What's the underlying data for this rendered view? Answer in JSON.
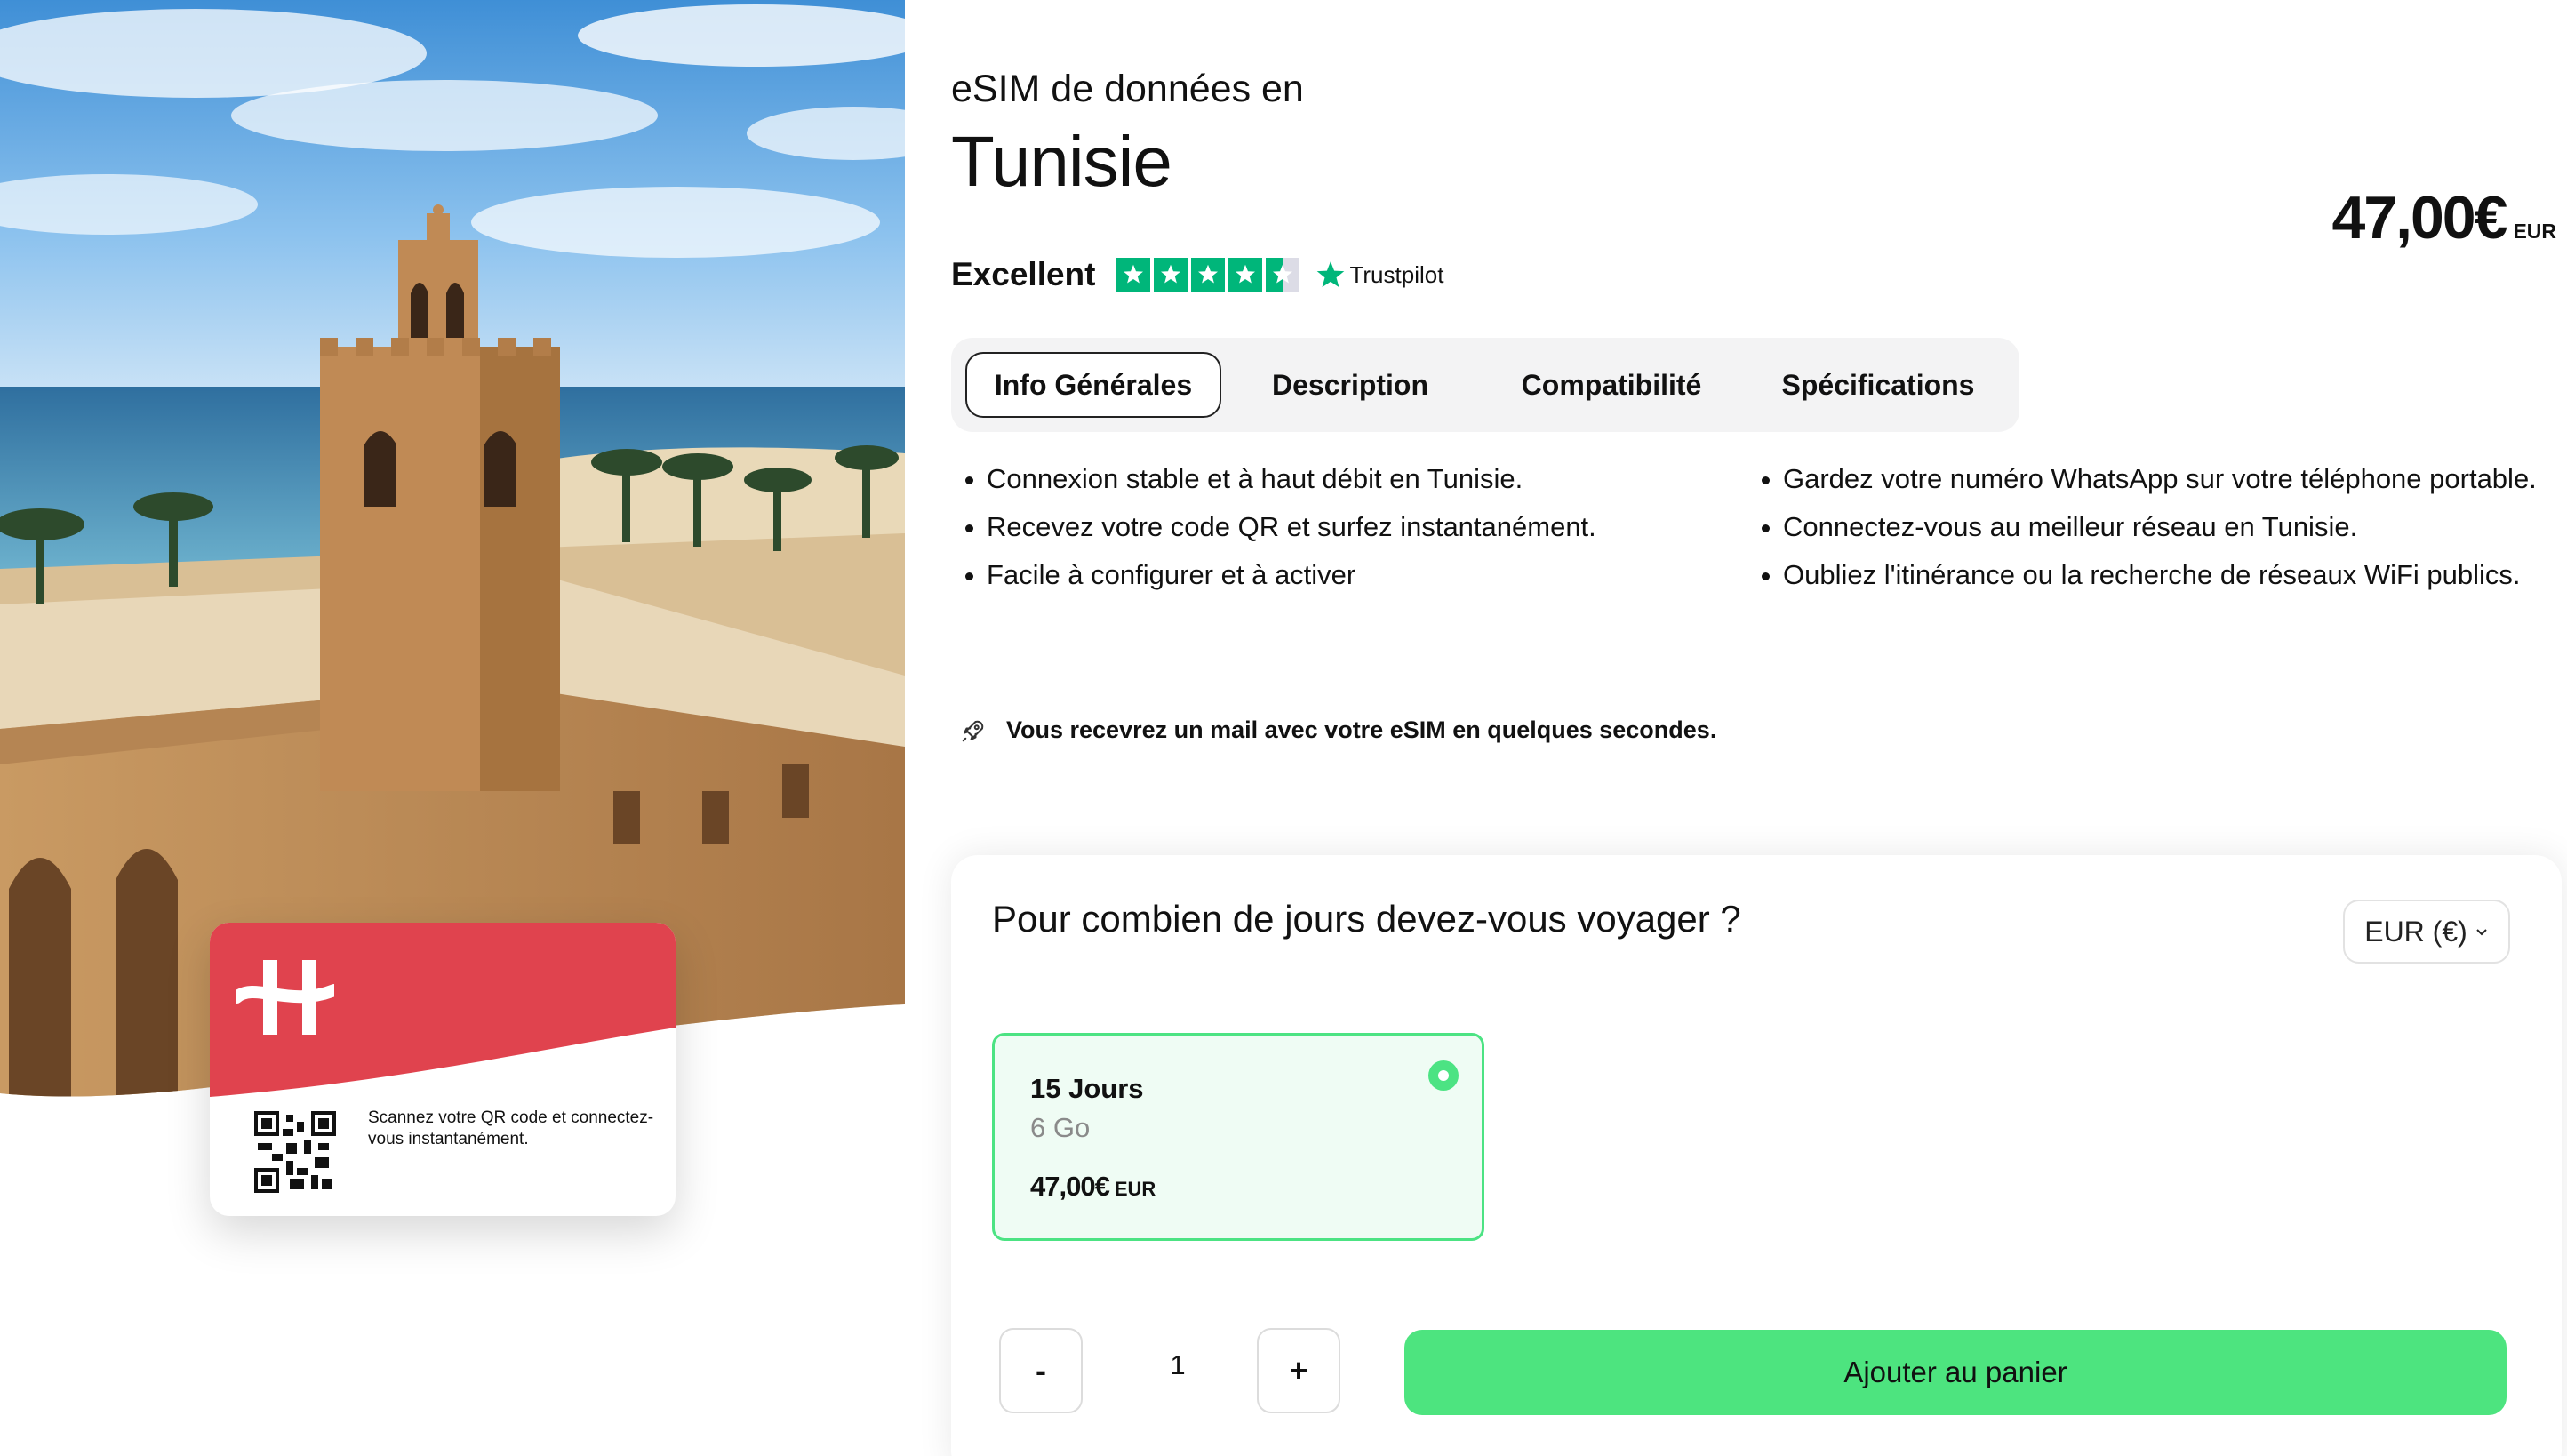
{
  "product": {
    "subtitle": "eSIM de données en",
    "title": "Tunisie",
    "price": "47,00€",
    "currency_code": "EUR"
  },
  "rating": {
    "label": "Excellent",
    "stars": 4.5,
    "provider": "Trustpilot",
    "star_color": "#00b67a"
  },
  "tabs": [
    {
      "label": "Info Générales",
      "active": true
    },
    {
      "label": "Description",
      "active": false
    },
    {
      "label": "Compatibilité",
      "active": false
    },
    {
      "label": "Spécifications",
      "active": false
    }
  ],
  "features_left": [
    "Connexion stable et à haut débit en Tunisie.",
    "Recevez votre code QR et surfez instantanément.",
    "Facile à configurer et à activer"
  ],
  "features_right": [
    "Gardez votre numéro WhatsApp sur votre téléphone portable.",
    "Connectez-vous au meilleur réseau en Tunisie.",
    "Oubliez l'itinérance ou la recherche de réseaux WiFi publics."
  ],
  "notice": {
    "icon": "rocket-icon",
    "text": "Vous recevrez un mail avec votre eSIM en quelques secondes."
  },
  "esim_card": {
    "brand_color": "#e0434e",
    "text": "Scannez votre QR code et connectez-vous instantanément."
  },
  "booking": {
    "question": "Pour combien de jours devez-vous voyager ?",
    "currency_selector": "EUR (€)",
    "plan": {
      "days": "15 Jours",
      "data": "6 Go",
      "price": "47,00€",
      "currency_code": "EUR",
      "selected": true
    },
    "quantity": {
      "minus": "-",
      "value": "1",
      "plus": "+"
    },
    "add_to_cart": "Ajouter au panier",
    "accent_color": "#4de47f"
  }
}
